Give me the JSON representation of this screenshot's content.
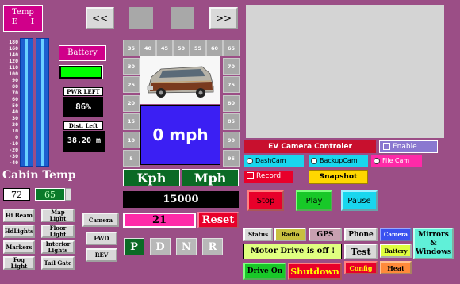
{
  "temp_panel": {
    "title": "Temp",
    "e_label": "E",
    "i_label": "I",
    "scale": [
      "180",
      "160",
      "140",
      "120",
      "110",
      "100",
      "90",
      "80",
      "70",
      "60",
      "50",
      "40",
      "30",
      "20",
      "10",
      "0",
      "-10",
      "-20",
      "-30",
      "-40"
    ],
    "cabin_label": "Cabin Temp",
    "cabin_value_1": "72",
    "cabin_value_2": "65"
  },
  "nav": {
    "prev": "<<",
    "next": ">>"
  },
  "battery": {
    "label": "Battery",
    "pwr_left_label": "PWR LEFT",
    "pwr_left_value": "86%",
    "dist_left_label": "Dist. Left",
    "dist_left_value": "38.20 m"
  },
  "speed_tiles": {
    "top": [
      "35",
      "40",
      "45",
      "50",
      "55",
      "60",
      "65"
    ],
    "left": [
      "30",
      "25",
      "20",
      "15",
      "10",
      "5"
    ],
    "right": [
      "70",
      "75",
      "80",
      "85",
      "90",
      "95"
    ]
  },
  "speed": {
    "value": "0 mph",
    "kph": "Kph",
    "mph": "Mph",
    "odometer": "15000",
    "trip": "21",
    "reset": "Reset"
  },
  "gears": [
    "P",
    "D",
    "N",
    "R"
  ],
  "lights": {
    "hi_beam": "Hi Beam",
    "map_light": "Map Light",
    "hdlights": "HdLights",
    "floor_light": "Floor Light",
    "markers": "Markers",
    "interior_lights": "Interior Lights",
    "fog_light": "Fog Light",
    "tail_gate": "Tail Gate"
  },
  "camera_col": {
    "camera": "Camera",
    "fwd": "FWD",
    "rev": "REV"
  },
  "ev_camera": {
    "title": "EV Camera Controler",
    "enable": "Enable",
    "dashcam": "DashCam",
    "backupcam": "BackupCam",
    "file_cam": "File Cam",
    "record": "Record",
    "snapshot": "Snapshot",
    "stop": "Stop",
    "play": "Play",
    "pause": "Pause"
  },
  "bottom_tabs": {
    "status": "Status",
    "radio": "Radio",
    "gps": "GPS",
    "phone": "Phone",
    "camera": "Camera",
    "mirrors": "Mirrors & Windows",
    "test": "Test",
    "battery": "Battery",
    "config": "Config",
    "heat": "Heat"
  },
  "motor": {
    "status": "Motor Drive is off !",
    "drive_on": "Drive On",
    "shutdown": "Shutdown"
  },
  "colors": {
    "background": "#9b4e86",
    "speed_display": "#3b1ff3",
    "battery_bar": "#00ff00",
    "title_red": "#c8102e"
  }
}
